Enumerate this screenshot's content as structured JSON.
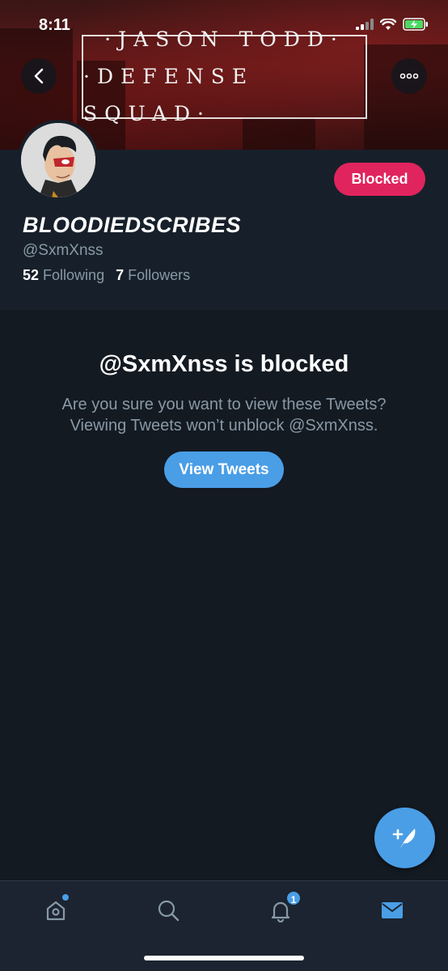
{
  "status_bar": {
    "time": "8:11"
  },
  "banner": {
    "line1": "·JASON TODD·",
    "line2": "·DEFENSE SQUAD·"
  },
  "profile": {
    "display_name": "BLOODIEDSCRIBES",
    "handle": "@SxmXnss",
    "following_count": "52",
    "following_label": "Following",
    "followers_count": "7",
    "followers_label": "Followers",
    "blocked_label": "Blocked"
  },
  "notice": {
    "title": "@SxmXnss is blocked",
    "line1": "Are you sure you want to view these Tweets?",
    "line2": "Viewing Tweets won’t unblock @SxmXnss.",
    "button_label": "View Tweets"
  },
  "tabbar": {
    "notifications_badge": "1"
  },
  "colors": {
    "background": "#141a22",
    "profile_bg": "#17202a",
    "accent": "#4a9ee6",
    "blocked": "#e0245e",
    "secondary_text": "#8899a6"
  },
  "icons": [
    "back-arrow-icon",
    "more-dots-icon",
    "cellular-signal-icon",
    "wifi-icon",
    "battery-charging-icon",
    "compose-tweet-icon",
    "home-icon",
    "search-icon",
    "notifications-bell-icon",
    "messages-envelope-icon"
  ]
}
